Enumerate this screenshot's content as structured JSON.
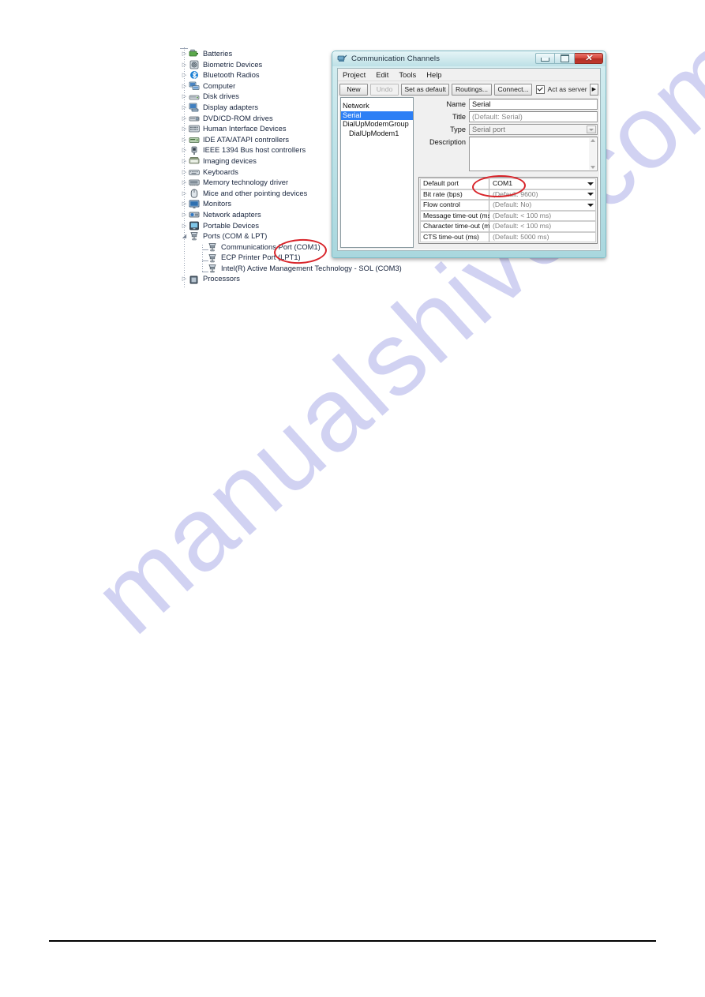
{
  "watermark": {
    "text": "manualshive.com",
    "color": "#c9cbf0"
  },
  "device_manager": {
    "name": "device-manager-tree",
    "items": [
      {
        "label": "Batteries",
        "level": 0,
        "expandable": true,
        "icon": "battery-icon"
      },
      {
        "label": "Biometric Devices",
        "level": 0,
        "expandable": true,
        "icon": "biometric-icon"
      },
      {
        "label": "Bluetooth Radios",
        "level": 0,
        "expandable": true,
        "icon": "bluetooth-icon"
      },
      {
        "label": "Computer",
        "level": 0,
        "expandable": true,
        "icon": "computer-icon"
      },
      {
        "label": "Disk drives",
        "level": 0,
        "expandable": true,
        "icon": "disk-drive-icon"
      },
      {
        "label": "Display adapters",
        "level": 0,
        "expandable": true,
        "icon": "display-adapter-icon"
      },
      {
        "label": "DVD/CD-ROM drives",
        "level": 0,
        "expandable": true,
        "icon": "dvd-drive-icon"
      },
      {
        "label": "Human Interface Devices",
        "level": 0,
        "expandable": true,
        "icon": "hid-icon"
      },
      {
        "label": "IDE ATA/ATAPI controllers",
        "level": 0,
        "expandable": true,
        "icon": "ide-controller-icon"
      },
      {
        "label": "IEEE 1394 Bus host controllers",
        "level": 0,
        "expandable": true,
        "icon": "ieee1394-icon"
      },
      {
        "label": "Imaging devices",
        "level": 0,
        "expandable": true,
        "icon": "imaging-icon"
      },
      {
        "label": "Keyboards",
        "level": 0,
        "expandable": true,
        "icon": "keyboard-icon"
      },
      {
        "label": "Memory technology driver",
        "level": 0,
        "expandable": true,
        "icon": "memory-icon"
      },
      {
        "label": "Mice and other pointing devices",
        "level": 0,
        "expandable": true,
        "icon": "mouse-icon"
      },
      {
        "label": "Monitors",
        "level": 0,
        "expandable": true,
        "icon": "monitor-icon"
      },
      {
        "label": "Network adapters",
        "level": 0,
        "expandable": true,
        "icon": "network-adapter-icon"
      },
      {
        "label": "Portable Devices",
        "level": 0,
        "expandable": true,
        "icon": "portable-device-icon"
      },
      {
        "label": "Ports (COM & LPT)",
        "level": 0,
        "expandable": true,
        "expanded": true,
        "icon": "port-icon"
      },
      {
        "label": "Communications Port (COM1)",
        "level": 1,
        "expandable": false,
        "icon": "port-icon"
      },
      {
        "label": "ECP Printer Port (LPT1)",
        "level": 1,
        "expandable": false,
        "icon": "port-icon"
      },
      {
        "label": "Intel(R) Active Management Technology - SOL (COM3)",
        "level": 1,
        "expandable": false,
        "icon": "port-icon"
      },
      {
        "label": "Processors",
        "level": 0,
        "expandable": true,
        "icon": "processor-icon"
      }
    ]
  },
  "comm_window": {
    "title": "Communication Channels",
    "window_buttons": {
      "minimize": "minimize",
      "maximize": "maximize",
      "close": "close"
    },
    "menu": [
      "Project",
      "Edit",
      "Tools",
      "Help"
    ],
    "toolbar": {
      "new_label": "New",
      "undo_label": "Undo",
      "set_default_label": "Set as default",
      "routings_label": "Routings...",
      "connect_label": "Connect...",
      "act_as_server_label": "Act as server",
      "act_as_server_checked": true,
      "overflow_label": "▶"
    },
    "channel_list": [
      {
        "label": "Network",
        "selected": false,
        "indent": false
      },
      {
        "label": "Serial",
        "selected": true,
        "indent": false
      },
      {
        "label": "DialUpModemGroup",
        "selected": false,
        "indent": false
      },
      {
        "label": "DialUpModem1",
        "selected": false,
        "indent": true
      }
    ],
    "form": {
      "name_label": "Name",
      "name_value": "Serial",
      "title_label": "Title",
      "title_value": "(Default: Serial)",
      "type_label": "Type",
      "type_value": "Serial port",
      "description_label": "Description",
      "description_value": ""
    },
    "properties": {
      "rows": [
        {
          "key": "Default port",
          "value": "COM1",
          "dropdown": true,
          "value_set": true
        },
        {
          "key": "Bit rate (bps)",
          "value": "(Default: 9600)",
          "dropdown": true,
          "value_set": false
        },
        {
          "key": "Flow control",
          "value": "(Default: No)",
          "dropdown": true,
          "value_set": false
        },
        {
          "key": "Message time-out (ms)",
          "value": "(Default: < 100 ms)",
          "dropdown": false,
          "value_set": false
        },
        {
          "key": "Character time-out (ms)",
          "value": "(Default: < 100 ms)",
          "dropdown": false,
          "value_set": false
        },
        {
          "key": "CTS time-out (ms)",
          "value": "(Default: 5000 ms)",
          "dropdown": false,
          "value_set": false
        }
      ]
    }
  },
  "annotations": {
    "color": "#d8242a",
    "ellipses": [
      {
        "name": "highlight-communications-port-com1",
        "target": "Communications Port (COM1)"
      },
      {
        "name": "highlight-default-port-com1",
        "target": "COM1"
      }
    ]
  }
}
